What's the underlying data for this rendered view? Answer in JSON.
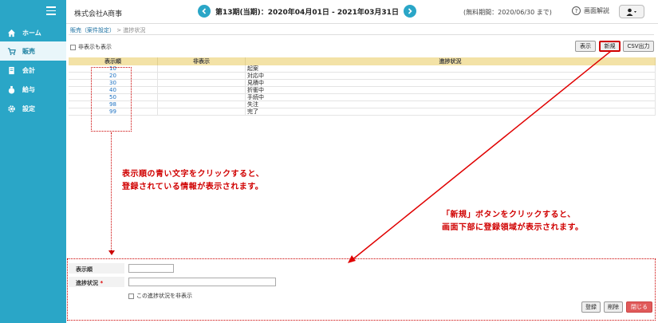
{
  "sidebar": {
    "items": [
      {
        "label": "ホーム",
        "icon": "home-icon"
      },
      {
        "label": "販売",
        "icon": "cart-icon"
      },
      {
        "label": "会計",
        "icon": "ledger-icon"
      },
      {
        "label": "給与",
        "icon": "moneybag-icon"
      },
      {
        "label": "設定",
        "icon": "gear-icon"
      }
    ]
  },
  "header": {
    "company": "株式会社A商事",
    "period": "第13期(当期)：2020年04月01日 - 2021年03月31日",
    "trial": "(無料期間：2020/06/30 まで)",
    "help": "画面解説"
  },
  "breadcrumb": {
    "link": "販売（案件設定）",
    "sep": " > ",
    "current": "進捗状況"
  },
  "show_hidden": "非表示も表示",
  "toolbar": {
    "display": "表示",
    "new": "新規",
    "csv": "CSV出力"
  },
  "table": {
    "headers": [
      "表示順",
      "非表示",
      "進捗状況"
    ],
    "rows": [
      {
        "order": "10",
        "hidden": "",
        "status": "起案"
      },
      {
        "order": "20",
        "hidden": "",
        "status": "対応中"
      },
      {
        "order": "30",
        "hidden": "",
        "status": "見積中"
      },
      {
        "order": "40",
        "hidden": "",
        "status": "折衝中"
      },
      {
        "order": "50",
        "hidden": "",
        "status": "手続中"
      },
      {
        "order": "98",
        "hidden": "",
        "status": "失注"
      },
      {
        "order": "99",
        "hidden": "",
        "status": "完了"
      }
    ]
  },
  "annotations": {
    "left_line1": "表示順の青い文字をクリックすると、",
    "left_line2": "登録されている情報が表示されます。",
    "right_line1": "「新規」ボタンをクリックすると、",
    "right_line2": "画面下部に登録領域が表示されます。"
  },
  "form": {
    "order_label": "表示順",
    "status_label": "進捗状況",
    "required_mark": "*",
    "order_value": "",
    "status_value": "",
    "hide_label": "この進捗状況を非表示",
    "register": "登録",
    "delete": "削除",
    "close": "閉じる"
  },
  "colors": {
    "sidebar": "#2aa6c7",
    "annotation": "#d00000",
    "table_header": "#f3e2a6",
    "close_button": "#e05a5a"
  }
}
